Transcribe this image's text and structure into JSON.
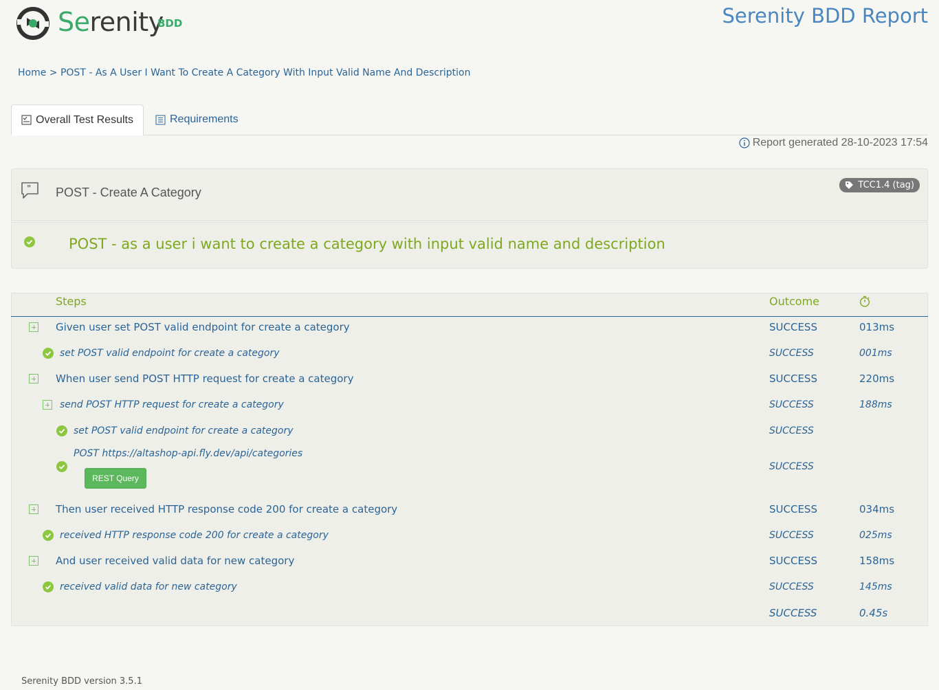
{
  "header": {
    "logo_prefix": "Se",
    "logo_rest": "renity",
    "logo_suffix": "BDD",
    "report_title": "Serenity BDD Report"
  },
  "breadcrumb": "Home > POST - As A User I Want To Create A Category With Input Valid Name And Description",
  "tabs": [
    {
      "label": "Overall Test Results",
      "active": true
    },
    {
      "label": "Requirements",
      "active": false
    }
  ],
  "report_generated": "Report generated 28-10-2023 17:54",
  "feature": {
    "title": "POST - Create A Category",
    "tag": "TCC1.4 (tag)"
  },
  "scenario": {
    "title": "POST - as a user i want to create a category with input valid name and description",
    "status": "passed"
  },
  "steps_table": {
    "headers": {
      "steps": "Steps",
      "outcome": "Outcome",
      "duration_icon": "stopwatch-icon"
    },
    "rows": [
      {
        "text": "Given user set POST valid endpoint for create a category",
        "outcome": "SUCCESS",
        "duration": "013ms",
        "level": 0,
        "kind": "expand"
      },
      {
        "text": "set POST valid endpoint for create a category",
        "outcome": "SUCCESS",
        "duration": "001ms",
        "level": 1,
        "kind": "check"
      },
      {
        "text": "When user send POST HTTP request for create a category",
        "outcome": "SUCCESS",
        "duration": "220ms",
        "level": 0,
        "kind": "expand"
      },
      {
        "text": "send POST HTTP request for create a category",
        "outcome": "SUCCESS",
        "duration": "188ms",
        "level": 1,
        "kind": "expand"
      },
      {
        "text": "set POST valid endpoint for create a category",
        "outcome": "SUCCESS",
        "duration": "",
        "level": 2,
        "kind": "check"
      },
      {
        "text": "POST https://altashop-api.fly.dev/api/categories",
        "outcome": "SUCCESS",
        "duration": "",
        "level": 2,
        "kind": "check",
        "button": "REST Query"
      },
      {
        "text": "Then user received HTTP response code 200 for create a category",
        "outcome": "SUCCESS",
        "duration": "034ms",
        "level": 0,
        "kind": "expand"
      },
      {
        "text": "received HTTP response code 200 for create a category",
        "outcome": "SUCCESS",
        "duration": "025ms",
        "level": 1,
        "kind": "check"
      },
      {
        "text": "And user received valid data for new category",
        "outcome": "SUCCESS",
        "duration": "158ms",
        "level": 0,
        "kind": "expand"
      },
      {
        "text": "received valid data for new category",
        "outcome": "SUCCESS",
        "duration": "145ms",
        "level": 1,
        "kind": "check"
      }
    ],
    "total": {
      "outcome": "SUCCESS",
      "duration": "0.45s"
    }
  },
  "footer": "Serenity BDD version 3.5.1",
  "colors": {
    "accent_green": "#7ea81e",
    "link_blue": "#2a6496",
    "success_green": "#8dc63f",
    "button_green": "#5cb85c"
  }
}
